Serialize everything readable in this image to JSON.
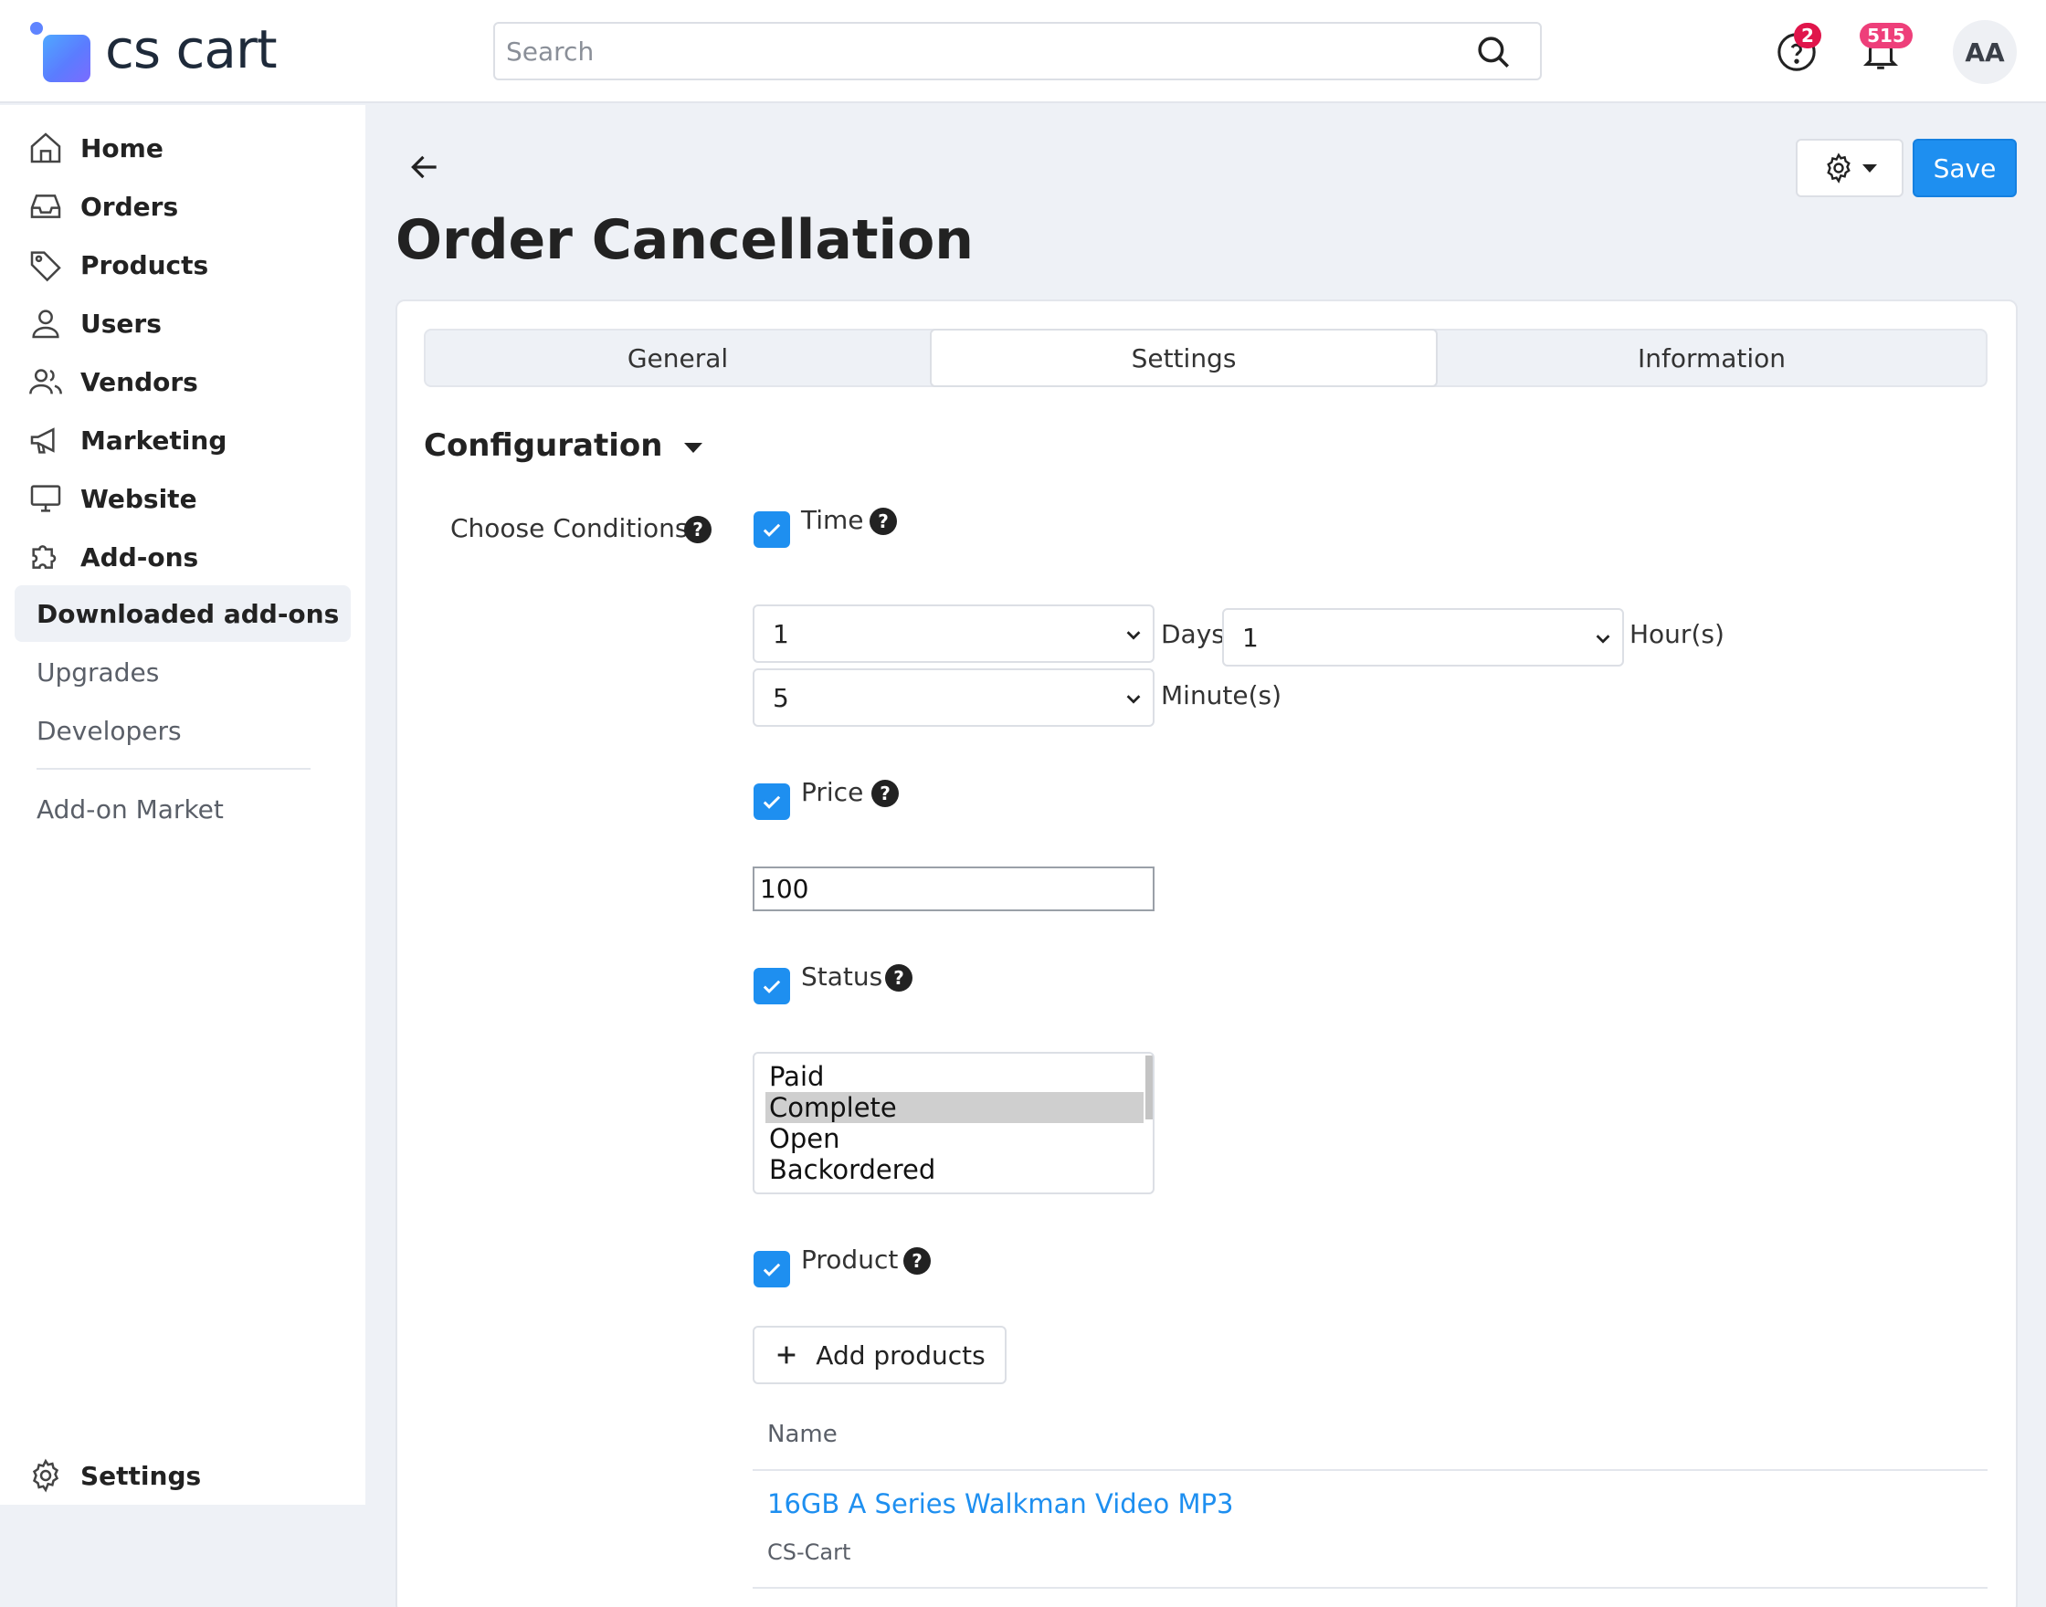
{
  "header": {
    "logo_text": "cs cart",
    "search_placeholder": "Search",
    "help_badge": "2",
    "notifications_badge": "515",
    "avatar_initials": "AA"
  },
  "sidebar": {
    "items": [
      {
        "label": "Home",
        "icon": "home-icon"
      },
      {
        "label": "Orders",
        "icon": "inbox-icon"
      },
      {
        "label": "Products",
        "icon": "tag-icon"
      },
      {
        "label": "Users",
        "icon": "user-icon"
      },
      {
        "label": "Vendors",
        "icon": "users-icon"
      },
      {
        "label": "Marketing",
        "icon": "megaphone-icon"
      },
      {
        "label": "Website",
        "icon": "monitor-icon"
      },
      {
        "label": "Add-ons",
        "icon": "puzzle-icon"
      }
    ],
    "sub_items": [
      "Downloaded add-ons",
      "Upgrades",
      "Developers"
    ],
    "market": "Add-on Market",
    "settings": "Settings"
  },
  "page": {
    "title": "Order Cancellation",
    "save_label": "Save"
  },
  "tabs": [
    "General",
    "Settings",
    "Information"
  ],
  "section": {
    "title": "Configuration",
    "choose_conditions_label": "Choose Conditions:"
  },
  "conditions": {
    "time": {
      "label": "Time",
      "days_value": "1",
      "days_unit": "Days",
      "hours_value": "1",
      "hours_unit": "Hour(s)",
      "minutes_value": "5",
      "minutes_unit": "Minute(s)"
    },
    "price": {
      "label": "Price",
      "value": "100"
    },
    "status": {
      "label": "Status",
      "options": [
        "Paid",
        "Complete",
        "Open",
        "Backordered"
      ]
    },
    "product": {
      "label": "Product",
      "add_label": "Add products",
      "column_name": "Name",
      "product_name": "16GB A Series Walkman Video MP3",
      "vendor": "CS-Cart"
    }
  },
  "colors": {
    "accent": "#1e8ff0",
    "badge_red": "#e0154b",
    "badge_pink": "#ee3f7a"
  }
}
